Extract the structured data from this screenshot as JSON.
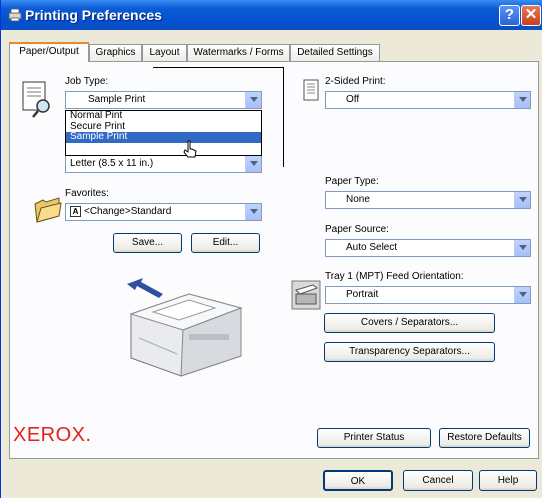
{
  "window": {
    "title": "Printing Preferences",
    "help_glyph": "?",
    "close_glyph": "✕"
  },
  "tabs": [
    {
      "label": "Paper/Output",
      "active": true
    },
    {
      "label": "Graphics",
      "active": false
    },
    {
      "label": "Layout",
      "active": false
    },
    {
      "label": "Watermarks / Forms",
      "active": false
    },
    {
      "label": "Detailed Settings",
      "active": false
    }
  ],
  "job_type": {
    "label": "Job Type:",
    "value": "Sample Print",
    "options": [
      "Normal Pint",
      "Secure Print",
      "Sample Print"
    ],
    "selected_option": "Sample Print"
  },
  "paper_size": {
    "value": "Letter (8.5 x 11 in.)"
  },
  "favorites": {
    "label": "Favorites:",
    "value": "<Change>Standard",
    "save_button": "Save...",
    "edit_button": "Edit..."
  },
  "two_sided": {
    "label": "2-Sided Print:",
    "value": "Off"
  },
  "paper_type": {
    "label": "Paper Type:",
    "value": "None"
  },
  "paper_source": {
    "label": "Paper Source:",
    "value": "Auto Select"
  },
  "feed_orientation": {
    "label": "Tray 1 (MPT) Feed Orientation:",
    "value": "Portrait"
  },
  "covers_button": "Covers / Separators...",
  "transparency_button": "Transparency Separators...",
  "brand": "XEROX.",
  "printer_status_button": "Printer Status",
  "restore_defaults_button": "Restore Defaults",
  "dialog_buttons": {
    "ok": "OK",
    "cancel": "Cancel",
    "help": "Help"
  },
  "colors": {
    "titlebar": "#0a5bd6",
    "selection": "#316ac5",
    "brand": "#e2231a",
    "dialog_bg": "#ece9d8"
  }
}
